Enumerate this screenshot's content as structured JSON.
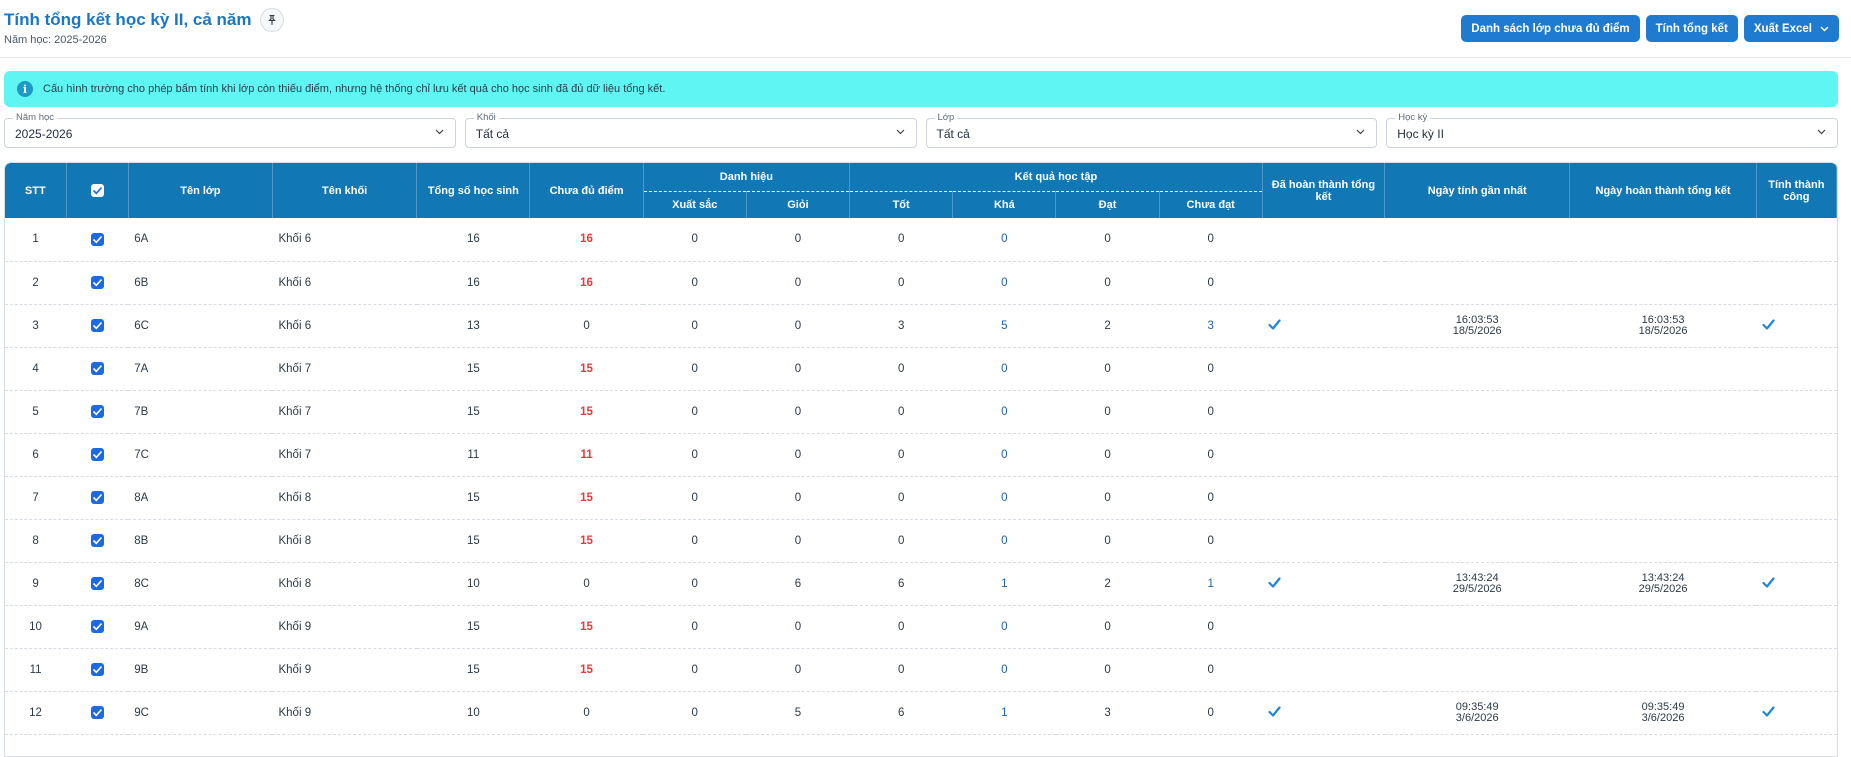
{
  "header": {
    "title": "Tính tổng kết học kỳ II, cả năm",
    "subtitle": "Năm học: 2025-2026",
    "buttons": {
      "missing_list": "Danh sách lớp chưa đủ điểm",
      "calculate": "Tính tổng kết",
      "export": "Xuất Excel"
    }
  },
  "alert": {
    "text": "Cấu hình trường cho phép bấm tính khi lớp còn thiếu điểm, nhưng hệ thống chỉ lưu kết quả cho học sinh đã đủ dữ liệu tổng kết."
  },
  "filters": [
    {
      "label": "Năm học",
      "value": "2025-2026"
    },
    {
      "label": "Khối",
      "value": "Tất cả"
    },
    {
      "label": "Lớp",
      "value": "Tất cả"
    },
    {
      "label": "Học kỳ",
      "value": "Học kỳ II"
    }
  ],
  "table": {
    "headers": {
      "stt": "STT",
      "class_name": "Tên lớp",
      "grade_name": "Tên khối",
      "total_students": "Tổng số học sinh",
      "missing_scores": "Chưa đủ điểm",
      "title_group": "Danh hiệu",
      "excellent": "Xuất sắc",
      "good_student": "Giỏi",
      "result_group": "Kết quả học tập",
      "tot": "Tốt",
      "kha": "Khá",
      "dat": "Đạt",
      "chua_dat": "Chưa đạt",
      "completed": "Đã hoàn thành tổng kết",
      "last_calc": "Ngày tính gần nhất",
      "completed_date": "Ngày hoàn thành tổng kết",
      "success": "Tính thành công"
    },
    "rows": [
      {
        "stt": "1",
        "class_name": "6A",
        "grade": "Khối 6",
        "total": "16",
        "missing": "16",
        "xs": "0",
        "gioi": "0",
        "tot": "0",
        "kha": "0",
        "dat": "0",
        "chua_dat": "0",
        "done": false,
        "last_time": "",
        "last_date": "",
        "done_time": "",
        "done_date": "",
        "success": false
      },
      {
        "stt": "2",
        "class_name": "6B",
        "grade": "Khối 6",
        "total": "16",
        "missing": "16",
        "xs": "0",
        "gioi": "0",
        "tot": "0",
        "kha": "0",
        "dat": "0",
        "chua_dat": "0",
        "done": false,
        "last_time": "",
        "last_date": "",
        "done_time": "",
        "done_date": "",
        "success": false
      },
      {
        "stt": "3",
        "class_name": "6C",
        "grade": "Khối 6",
        "total": "13",
        "missing": "0",
        "xs": "0",
        "gioi": "0",
        "tot": "3",
        "kha": "5",
        "dat": "2",
        "chua_dat": "3",
        "done": true,
        "last_time": "16:03:53",
        "last_date": "18/5/2026",
        "done_time": "16:03:53",
        "done_date": "18/5/2026",
        "success": true
      },
      {
        "stt": "4",
        "class_name": "7A",
        "grade": "Khối 7",
        "total": "15",
        "missing": "15",
        "xs": "0",
        "gioi": "0",
        "tot": "0",
        "kha": "0",
        "dat": "0",
        "chua_dat": "0",
        "done": false,
        "last_time": "",
        "last_date": "",
        "done_time": "",
        "done_date": "",
        "success": false
      },
      {
        "stt": "5",
        "class_name": "7B",
        "grade": "Khối 7",
        "total": "15",
        "missing": "15",
        "xs": "0",
        "gioi": "0",
        "tot": "0",
        "kha": "0",
        "dat": "0",
        "chua_dat": "0",
        "done": false,
        "last_time": "",
        "last_date": "",
        "done_time": "",
        "done_date": "",
        "success": false
      },
      {
        "stt": "6",
        "class_name": "7C",
        "grade": "Khối 7",
        "total": "11",
        "missing": "11",
        "xs": "0",
        "gioi": "0",
        "tot": "0",
        "kha": "0",
        "dat": "0",
        "chua_dat": "0",
        "done": false,
        "last_time": "",
        "last_date": "",
        "done_time": "",
        "done_date": "",
        "success": false
      },
      {
        "stt": "7",
        "class_name": "8A",
        "grade": "Khối 8",
        "total": "15",
        "missing": "15",
        "xs": "0",
        "gioi": "0",
        "tot": "0",
        "kha": "0",
        "dat": "0",
        "chua_dat": "0",
        "done": false,
        "last_time": "",
        "last_date": "",
        "done_time": "",
        "done_date": "",
        "success": false
      },
      {
        "stt": "8",
        "class_name": "8B",
        "grade": "Khối 8",
        "total": "15",
        "missing": "15",
        "xs": "0",
        "gioi": "0",
        "tot": "0",
        "kha": "0",
        "dat": "0",
        "chua_dat": "0",
        "done": false,
        "last_time": "",
        "last_date": "",
        "done_time": "",
        "done_date": "",
        "success": false
      },
      {
        "stt": "9",
        "class_name": "8C",
        "grade": "Khối 8",
        "total": "10",
        "missing": "0",
        "xs": "0",
        "gioi": "6",
        "tot": "6",
        "kha": "1",
        "dat": "2",
        "chua_dat": "1",
        "done": true,
        "last_time": "13:43:24",
        "last_date": "29/5/2026",
        "done_time": "13:43:24",
        "done_date": "29/5/2026",
        "success": true
      },
      {
        "stt": "10",
        "class_name": "9A",
        "grade": "Khối 9",
        "total": "15",
        "missing": "15",
        "xs": "0",
        "gioi": "0",
        "tot": "0",
        "kha": "0",
        "dat": "0",
        "chua_dat": "0",
        "done": false,
        "last_time": "",
        "last_date": "",
        "done_time": "",
        "done_date": "",
        "success": false
      },
      {
        "stt": "11",
        "class_name": "9B",
        "grade": "Khối 9",
        "total": "15",
        "missing": "15",
        "xs": "0",
        "gioi": "0",
        "tot": "0",
        "kha": "0",
        "dat": "0",
        "chua_dat": "0",
        "done": false,
        "last_time": "",
        "last_date": "",
        "done_time": "",
        "done_date": "",
        "success": false
      },
      {
        "stt": "12",
        "class_name": "9C",
        "grade": "Khối 9",
        "total": "10",
        "missing": "0",
        "xs": "0",
        "gioi": "5",
        "tot": "6",
        "kha": "1",
        "dat": "3",
        "chua_dat": "0",
        "done": true,
        "last_time": "09:35:49",
        "last_date": "3/6/2026",
        "done_time": "09:35:49",
        "done_date": "3/6/2026",
        "success": true
      }
    ]
  },
  "colors": {
    "accent": "#1178b5",
    "button": "#1e7bd0",
    "alert_bg": "#5ff5f3",
    "warning_text": "#e33b3b",
    "checkbox": "#1b6ae0",
    "check_mark": "#1e86d8"
  },
  "icons": {
    "pin": "pin-icon",
    "info": "info-icon",
    "chevron": "chevron-down-icon",
    "check": "check-icon"
  }
}
